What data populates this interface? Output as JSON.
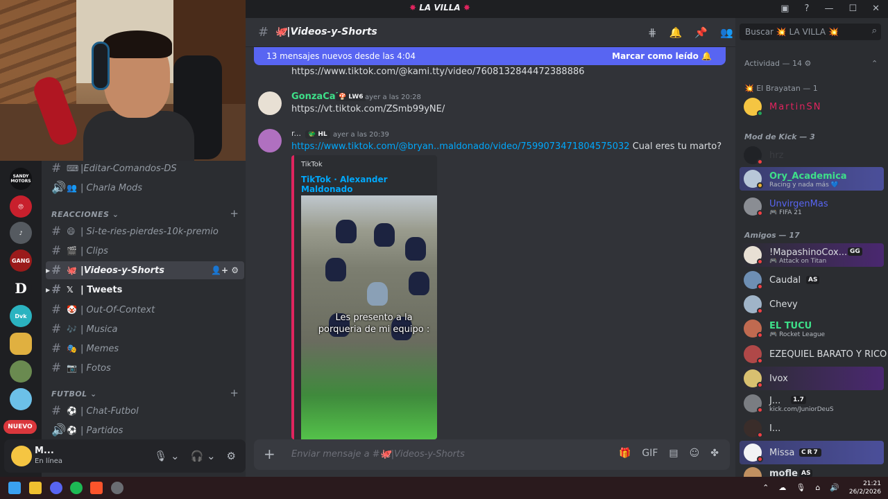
{
  "window": {
    "server_title": "LA VILLA",
    "controls": [
      "inbox-icon",
      "help-icon",
      "minimize-icon",
      "maximize-icon",
      "close-icon"
    ]
  },
  "servers": [
    {
      "name": "SANDY MOTORS",
      "color": "#111214"
    },
    {
      "name": "",
      "color": "#c8202d"
    },
    {
      "name": "",
      "color": "#555a60"
    },
    {
      "name": "GANG",
      "color": "#9b1b1b"
    },
    {
      "name": "D",
      "color": "#1e1f22"
    },
    {
      "name": "Dvk",
      "color": "#2bb3c0"
    },
    {
      "name": "",
      "color": "#e0b040"
    },
    {
      "name": "",
      "color": "#6a8a50"
    },
    {
      "name": "",
      "color": "#6cc0e8"
    }
  ],
  "nuevo_badge": "NUEVO",
  "channels": [
    {
      "type": "text",
      "emoji": "⌨",
      "label": "|Editar-Comandos-DS"
    },
    {
      "type": "voice",
      "emoji": "👥",
      "label": "| Charla Mods"
    }
  ],
  "category_reacciones": "REACCIONES",
  "reacciones_channels": [
    {
      "type": "text",
      "emoji": "😄",
      "label": "| Si-te-ries-pierdes-10k-premio"
    },
    {
      "type": "text",
      "emoji": "🎬",
      "label": "| Clips"
    },
    {
      "type": "text",
      "emoji": "🐙",
      "label": "|Videos-y-Shorts",
      "active": true
    },
    {
      "type": "text",
      "emoji": "𝕏",
      "label": "| Tweets",
      "unread": true
    },
    {
      "type": "text",
      "emoji": "🤡",
      "label": "| Out-Of-Context"
    },
    {
      "type": "text",
      "emoji": "🎶",
      "label": "| Musica"
    },
    {
      "type": "text",
      "emoji": "🎭",
      "label": "| Memes"
    },
    {
      "type": "text",
      "emoji": "📷",
      "label": "| Fotos"
    }
  ],
  "category_futbol": "FUTBOL",
  "futbol_channels": [
    {
      "type": "text",
      "emoji": "⚽",
      "label": "| Chat-Futbol"
    },
    {
      "type": "voice",
      "emoji": "⚽",
      "label": "| Partidos"
    }
  ],
  "user_panel": {
    "name": "M...",
    "status": "En línea"
  },
  "header": {
    "channel": "🐙|Videos-y-Shorts"
  },
  "new_banner": {
    "text": "13 mensajes nuevos desde las 4:04",
    "action": "Marcar como leído"
  },
  "messages": [
    {
      "link": "https://www.tiktok.com/@kami.tty/video/7608132844472388886"
    },
    {
      "author": "GonzaCai",
      "author_color": "#3ee089",
      "tag": "LW6",
      "time": "ayer a las 20:28",
      "link": "https://vt.tiktok.com/ZSmb99yNE/"
    },
    {
      "author": "r...",
      "author_color": "#dbdee1",
      "tag": "HL",
      "time": "ayer a las 20:39",
      "link": "https://www.tiktok.com/@bryan..maldonado/video/7599073471804575032",
      "text": "Cual eres tu marto?"
    }
  ],
  "embed": {
    "provider": "TikTok",
    "title": "TikTok · Alexander Maldonado",
    "caption_line1": "Les presento a la",
    "caption_line2": "porqueria de mi equipo :"
  },
  "composer": {
    "placeholder": "Enviar mensaje a #🐙|Videos-y-Shorts"
  },
  "members": {
    "search_placeholder": "Buscar 💥 LA VILLA 💥",
    "activity_header": "Actividad — 14",
    "groups": [
      {
        "title": "El Brayatan — 1",
        "items": [
          {
            "name": "MartinSN",
            "color": "#e0245e"
          }
        ]
      },
      {
        "title": "Mod de Kick — 3",
        "items": [
          {
            "name": "hrz",
            "color": "#3b3d42"
          },
          {
            "name": "Ory_Academica",
            "color": "#3ee089",
            "status": "Racing y nada más 💙"
          },
          {
            "name": "UnvirgenMas",
            "color": "#5865f2",
            "status": "FIFA 21"
          }
        ]
      },
      {
        "title": "Amigos — 17",
        "items": [
          {
            "name": "!MapashinoCox...",
            "color": "#dbdee1",
            "tag": "GG",
            "status": "Attack on Titan"
          },
          {
            "name": "Caudal",
            "color": "#dbdee1",
            "tag": "AS"
          },
          {
            "name": "Chevy",
            "color": "#dbdee1"
          },
          {
            "name": "EL TUCU",
            "color": "#3ee089",
            "status": "Rocket League"
          },
          {
            "name": "EZEQUIEL BARATO Y RICO",
            "color": "#dbdee1"
          },
          {
            "name": "Ivox",
            "color": "#dbdee1"
          },
          {
            "name": "J...",
            "color": "#dbdee1",
            "tag": "1.7",
            "status": "kick.com/JuniorDeuS"
          },
          {
            "name": "I...",
            "color": "#dbdee1"
          },
          {
            "name": "Missa",
            "color": "#dbdee1",
            "tag": "CR7"
          },
          {
            "name": "mofle",
            "color": "#dbdee1",
            "tag": "AS"
          }
        ]
      }
    ]
  },
  "taskbar": {
    "time": "21:21",
    "date": "26/2/2026"
  }
}
